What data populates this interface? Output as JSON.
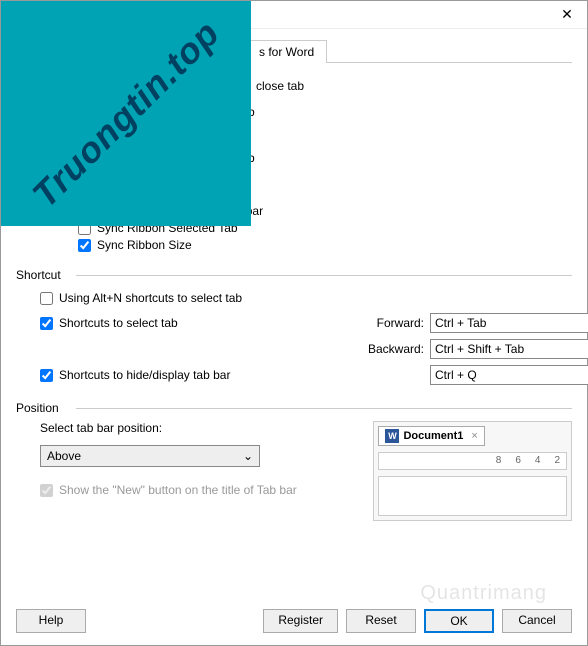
{
  "titlebar": {
    "close": "✕"
  },
  "watermark": "Truongtin.top",
  "tabs": {
    "for_word": "s for Word"
  },
  "appearance": {
    "line1": "close tab",
    "line2": "b",
    "line3": "b",
    "show_all_docs": "Show all documents in task bar",
    "sync_selected": "Sync Ribbon Selected Tab",
    "sync_size": "Sync Ribbon Size"
  },
  "shortcut": {
    "title": "Shortcut",
    "use_altn": "Using Alt+N shortcuts to select tab",
    "to_select": "Shortcuts to select tab",
    "to_hide": "Shortcuts to hide/display tab bar",
    "forward_label": "Forward:",
    "forward_value": "Ctrl + Tab",
    "backward_label": "Backward:",
    "backward_value": "Ctrl + Shift + Tab",
    "hide_value": "Ctrl + Q"
  },
  "position": {
    "title": "Position",
    "select_label": "Select tab bar position:",
    "select_value": "Above",
    "show_new": "Show the \"New\" button on the title of Tab bar",
    "doc_name": "Document1",
    "ruler": [
      "8",
      "6",
      "4",
      "2"
    ]
  },
  "buttons": {
    "help": "Help",
    "register": "Register",
    "reset": "Reset",
    "ok": "OK",
    "cancel": "Cancel"
  }
}
